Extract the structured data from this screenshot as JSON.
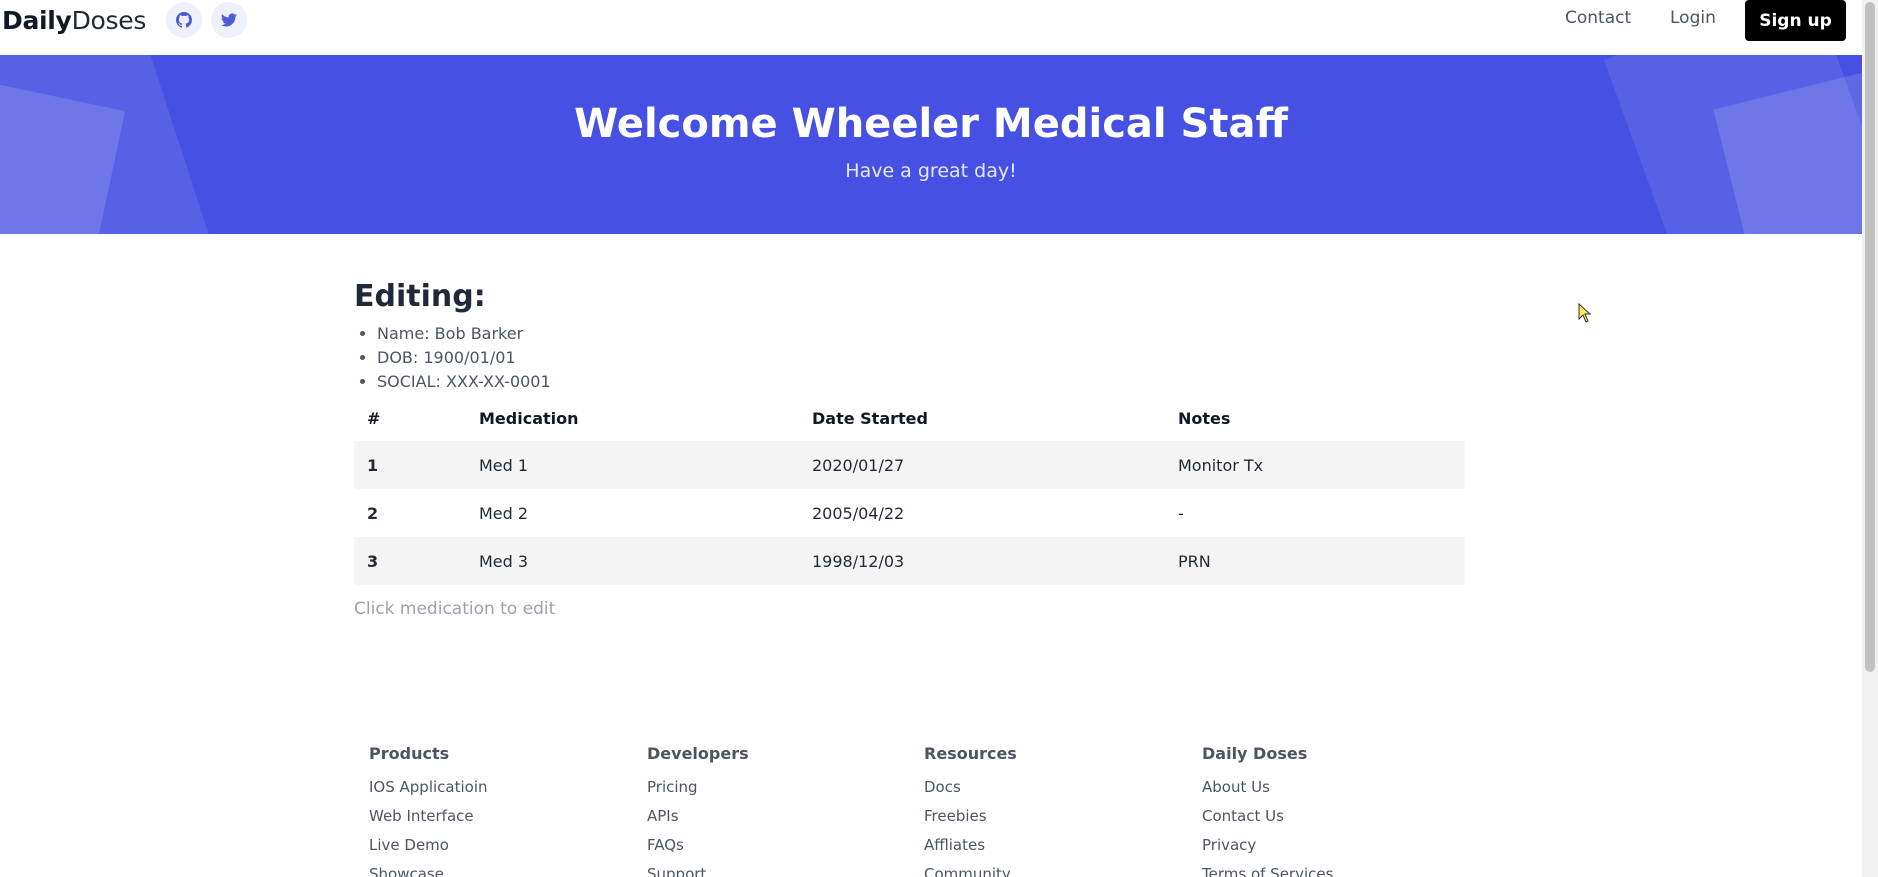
{
  "header": {
    "logo_bold": "Daily",
    "logo_light": "Doses",
    "nav": {
      "contact": "Contact",
      "login": "Login",
      "signup": "Sign up"
    }
  },
  "hero": {
    "title": "Welcome Wheeler Medical Staff",
    "subtitle": "Have a great day!"
  },
  "editing": {
    "heading": "Editing:",
    "patient": [
      "Name: Bob Barker",
      "DOB: 1900/01/01",
      "SOCIAL: XXX-XX-0001"
    ]
  },
  "medications": {
    "headers": [
      "#",
      "Medication",
      "Date Started",
      "Notes"
    ],
    "rows": [
      {
        "num": "1",
        "name": "Med 1",
        "date": "2020/01/27",
        "notes": "Monitor Tx"
      },
      {
        "num": "2",
        "name": "Med 2",
        "date": "2005/04/22",
        "notes": "-"
      },
      {
        "num": "3",
        "name": "Med 3",
        "date": "1998/12/03",
        "notes": "PRN"
      }
    ],
    "hint": "Click medication to edit"
  },
  "footer": {
    "columns": [
      {
        "title": "Products",
        "links": [
          "IOS Applicatioin",
          "Web Interface",
          "Live Demo",
          "Showcase"
        ]
      },
      {
        "title": "Developers",
        "links": [
          "Pricing",
          "APIs",
          "FAQs",
          "Support"
        ]
      },
      {
        "title": "Resources",
        "links": [
          "Docs",
          "Freebies",
          "Affliates",
          "Community"
        ]
      },
      {
        "title": "Daily Doses",
        "links": [
          "About Us",
          "Contact Us",
          "Privacy",
          "Terms of Services"
        ]
      }
    ]
  },
  "colors": {
    "hero_bg": "#4650e2",
    "signup_bg": "#000000",
    "icon_accent": "#4f5bd5"
  },
  "icons": {
    "github": "github-icon",
    "twitter": "twitter-icon"
  }
}
